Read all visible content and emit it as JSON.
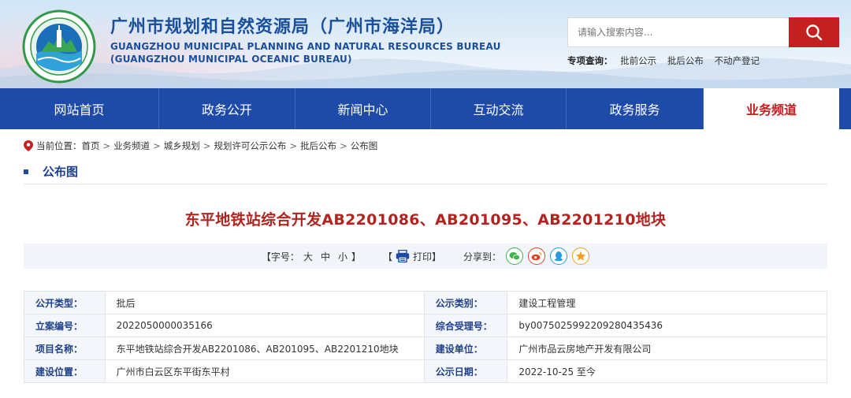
{
  "header": {
    "title": "广州市规划和自然资源局（广州市海洋局）",
    "subtitle_en_1": "GUANGZHOU MUNICIPAL PLANNING AND NATURAL RESOURCES BUREAU",
    "subtitle_en_2": "(GUANGZHOU MUNICIPAL OCEANIC BUREAU)",
    "search_placeholder": "请输入搜索内容...",
    "quick_label": "专项查询：",
    "quick_links": [
      "批前公示",
      "批后公布",
      "不动产登记"
    ]
  },
  "nav": {
    "items": [
      {
        "label": "网站首页"
      },
      {
        "label": "政务公开"
      },
      {
        "label": "新闻中心"
      },
      {
        "label": "互动交流"
      },
      {
        "label": "政务服务"
      },
      {
        "label": "业务频道"
      }
    ],
    "active_index": 5
  },
  "breadcrumb": {
    "prefix": "当前位置：",
    "items": [
      "首页",
      "业务频道",
      "城乡规划",
      "规划许可公示公布",
      "批后公布",
      "公布图"
    ],
    "separator": ">"
  },
  "section_title": "公布图",
  "article": {
    "title": "东平地铁站综合开发AB2201086、AB201095、AB2201210地块"
  },
  "toolbar": {
    "font_label": "【字号：",
    "font_sizes": [
      "大",
      "中",
      "小"
    ],
    "font_end": "】",
    "print_open": "【",
    "print_label": "打印",
    "print_close": "】",
    "share_label": "分享到："
  },
  "info": {
    "rows": [
      {
        "k1": "公开类型：",
        "v1": "批后",
        "k2": "公示类别：",
        "v2": "建设工程管理"
      },
      {
        "k1": "立案编号：",
        "v1": "2022050000035166",
        "k2": "综合受理号：",
        "v2": "by0075025992209280435436"
      },
      {
        "k1": "项目名称：",
        "v1": "东平地铁站综合开发AB2201086、AB201095、AB2201210地块",
        "k2": "建设单位：",
        "v2": "广州市品云房地产开发有限公司"
      },
      {
        "k1": "建设位置：",
        "v1": "广州市白云区东平街东平村",
        "k2": "公示日期：",
        "v2": "2022-10-25 至今"
      }
    ]
  },
  "colors": {
    "nav_bg": "#1e4aa8",
    "accent_red": "#c4201f",
    "title_red": "#b1241f",
    "brand_blue": "#1a4f9c"
  }
}
